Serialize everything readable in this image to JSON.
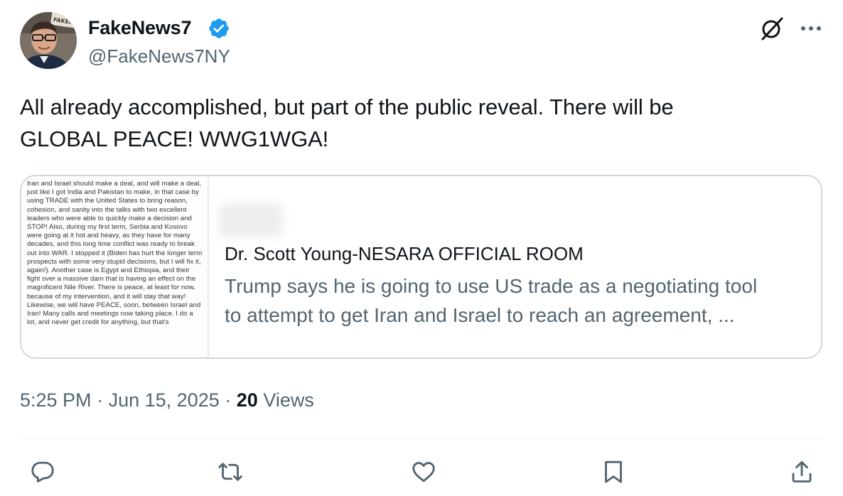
{
  "author": {
    "display_name": "FakeNews7",
    "handle": "@FakeNews7NY",
    "verified": true,
    "avatar_sign_text": "FAKENE"
  },
  "header_icons": [
    "grok-icon",
    "more-options-icon"
  ],
  "tweet": {
    "text_lines": [
      "All already accomplished, but part of the public reveal.  There will be",
      "GLOBAL PEACE!  WWG1WGA!"
    ]
  },
  "quoted_card": {
    "image_text": "Iran and Israel should make a deal, and will make a deal, just like I got India and Pakistan to make, in that case by using TRADE with the United States to bring reason, cohesion, and sanity into the talks with two excellent leaders who were able to quickly make a decision and STOP! Also, during my first term, Serbia and Kosovo were going at it hot and heavy, as they have for many decades, and this long time conflict was ready to break out into WAR. I stopped it (Biden has hurt the longer term prospects with some very stupid decisions, but I will fix it, again!). Another case is Egypt and Ethiopia, and their fight over a massive dam that is having an effect on the magnificent Nile River. There is peace, at least for now, because of my intervention, and it will stay that way! Likewise, we will have PEACE, soon, between Israel and Iran! Many calls and meetings now taking place. I do a lot, and never get credit for anything, but that's",
    "title": "Dr. Scott Young-NESARA OFFICIAL ROOM",
    "description_lines": [
      "Trump says he is going to use US trade as a negotiating tool",
      "to attempt to get Iran and Israel to reach an agreement, ..."
    ]
  },
  "meta": {
    "time": "5:25 PM",
    "separator": "·",
    "date": "Jun 15, 2025",
    "views_count": "20",
    "views_label": "Views"
  },
  "actions": [
    "reply-icon",
    "retweet-icon",
    "like-icon",
    "bookmark-icon",
    "share-icon"
  ],
  "colors": {
    "text_primary": "#0f1419",
    "text_secondary": "#536471",
    "verified_blue": "#1d9bf0",
    "border": "#cfd9de"
  }
}
